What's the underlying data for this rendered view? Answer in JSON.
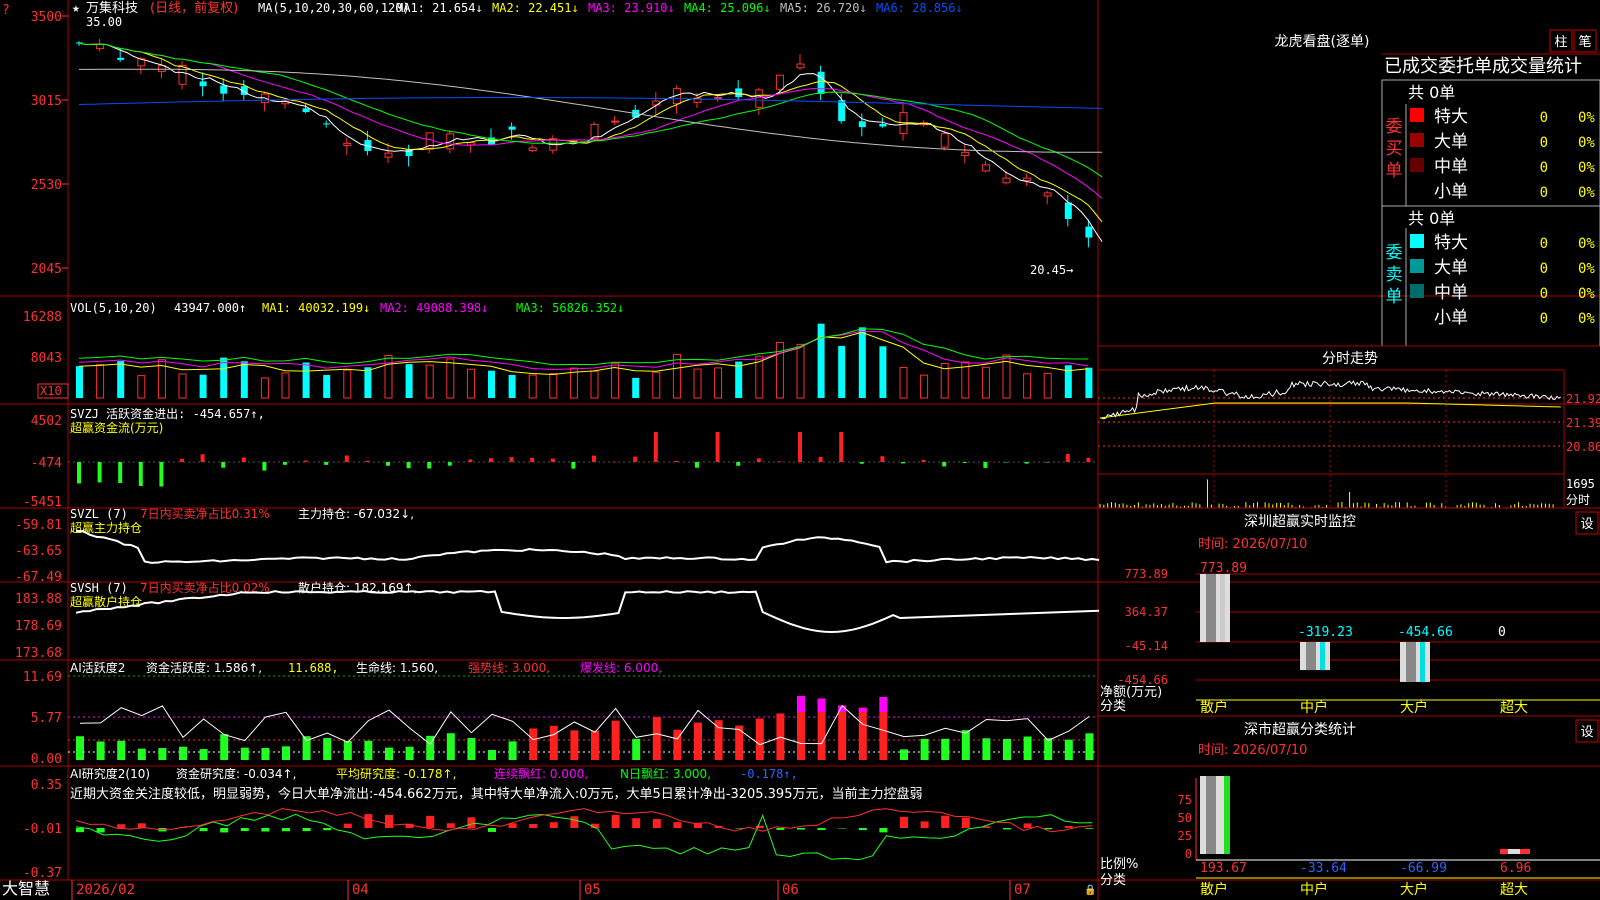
{
  "stock": {
    "name": "万集科技",
    "period": "(日线，前复权)",
    "max_label": "35.00",
    "min_label": "20.45"
  },
  "ma": {
    "head": "MA(5,10,20,30,60,120)",
    "items": [
      {
        "text": "MA1: 21.654↓",
        "color": "#ffffff"
      },
      {
        "text": "MA2: 22.451↓",
        "color": "#ffff00"
      },
      {
        "text": "MA3: 23.910↓",
        "color": "#ff00ff"
      },
      {
        "text": "MA4: 25.096↓",
        "color": "#00ff00"
      },
      {
        "text": "MA5: 26.720↓",
        "color": "#c0c0c0"
      },
      {
        "text": "MA6: 28.856↓",
        "color": "#0050ff"
      }
    ]
  },
  "price_axis": [
    "3500",
    "3015",
    "2530",
    "2045"
  ],
  "vol": {
    "head": "VOL(5,10,20)",
    "val": "43947.000↑",
    "ma1": "MA1: 40032.199↓",
    "ma2": "MA2: 49088.398↓",
    "ma3": "MA3: 56826.352↓",
    "axis": [
      "16288",
      "8043"
    ],
    "unit": "X10"
  },
  "svzj": {
    "head": "SVZJ  活跃资金进出: -454.657↑,",
    "title": "超赢资金流(万元)",
    "axis": [
      "4502",
      "-474",
      "-5451"
    ]
  },
  "svzl": {
    "head": "SVZL (7)",
    "pct": "7日内买卖净占比0.31%",
    "hold": "主力持仓: -67.032↓,",
    "title": "超赢主力持仓",
    "axis": [
      "-59.81",
      "-63.65",
      "-67.49"
    ]
  },
  "svsh": {
    "head": "SVSH (7)",
    "pct": "7日内买卖净占比0.02%",
    "hold": "散户持仓: 182.169↑,",
    "title": "超赢散户持仓",
    "axis": [
      "183.88",
      "178.69",
      "173.68"
    ]
  },
  "ai1": {
    "head": "AI活跃度2",
    "a": "资金活跃度: 1.586↑,",
    "b": "11.688,",
    "c": "生命线: 1.560,",
    "d": "强势线: 3.000,",
    "e": "爆发线: 6.000,",
    "axis": [
      "11.69",
      "5.77",
      "0.00"
    ]
  },
  "ai2": {
    "head": "AI研究度2(10)",
    "a": "资金研究度: -0.034↑,",
    "b": "平均研究度: -0.178↑,",
    "c": "连续飘红: 0.000,",
    "d": "N日飘红: 3.000,",
    "e": "-0.178↑,",
    "note": "近期大资金关注度较低，明显弱势，今日大单净流出:-454.662万元，其中特大单净流入:0万元，大单5日累计净出-3205.395万元，当前主力控盘弱",
    "axis": [
      "0.35",
      "-0.01",
      "-0.37"
    ]
  },
  "date_axis": [
    "2026/02",
    "04",
    "05",
    "06",
    "07"
  ],
  "brand": "大智慧",
  "longhu": {
    "title": "龙虎看盘(逐单)",
    "btn1": "柱",
    "btn2": "笔",
    "subtitle": "已成交委托单成交量统计",
    "buy": {
      "total": "共 0单",
      "side": "委买单",
      "rows": [
        {
          "name": "特大",
          "v": "0",
          "p": "0%",
          "color": "#ff0000"
        },
        {
          "name": "大单",
          "v": "0",
          "p": "0%",
          "color": "#990000"
        },
        {
          "name": "中单",
          "v": "0",
          "p": "0%",
          "color": "#660000"
        },
        {
          "name": "小单",
          "v": "0",
          "p": "0%",
          "color": ""
        }
      ]
    },
    "sell": {
      "total": "共 0单",
      "side": "委卖单",
      "rows": [
        {
          "name": "特大",
          "v": "0",
          "p": "0%",
          "color": "#00ffff"
        },
        {
          "name": "大单",
          "v": "0",
          "p": "0%",
          "color": "#009999"
        },
        {
          "name": "中单",
          "v": "0",
          "p": "0%",
          "color": "#006b6b"
        },
        {
          "name": "小单",
          "v": "0",
          "p": "0%",
          "color": ""
        }
      ]
    }
  },
  "fenshi": {
    "title": "分时走势",
    "axis": [
      "21.92",
      "21.39",
      "20.86"
    ],
    "vol_axis": "1695",
    "unit": "分时"
  },
  "sz_monitor": {
    "title": "深圳超赢实时监控",
    "btn": "设",
    "time": "时间: 2026/07/10",
    "axis": [
      "773.89",
      "364.37",
      "-45.14",
      "-454.66"
    ],
    "ylabel1": "净额(万元)",
    "ylabel2": "分类",
    "cats": [
      "散户",
      "中户",
      "大户",
      "超大"
    ],
    "vals": [
      "773.89",
      "-319.23",
      "-454.66",
      "0"
    ]
  },
  "sz_stat": {
    "title": "深市超赢分类统计",
    "btn": "设",
    "time": "时间: 2026/07/10",
    "axis": [
      "75",
      "50",
      "25",
      "0"
    ],
    "ylabel1": "比例%",
    "ylabel2": "分类",
    "cats": [
      "散户",
      "中户",
      "大户",
      "超大"
    ],
    "vals": [
      "193.67",
      "-33.64",
      "-66.99",
      "6.96"
    ]
  }
}
